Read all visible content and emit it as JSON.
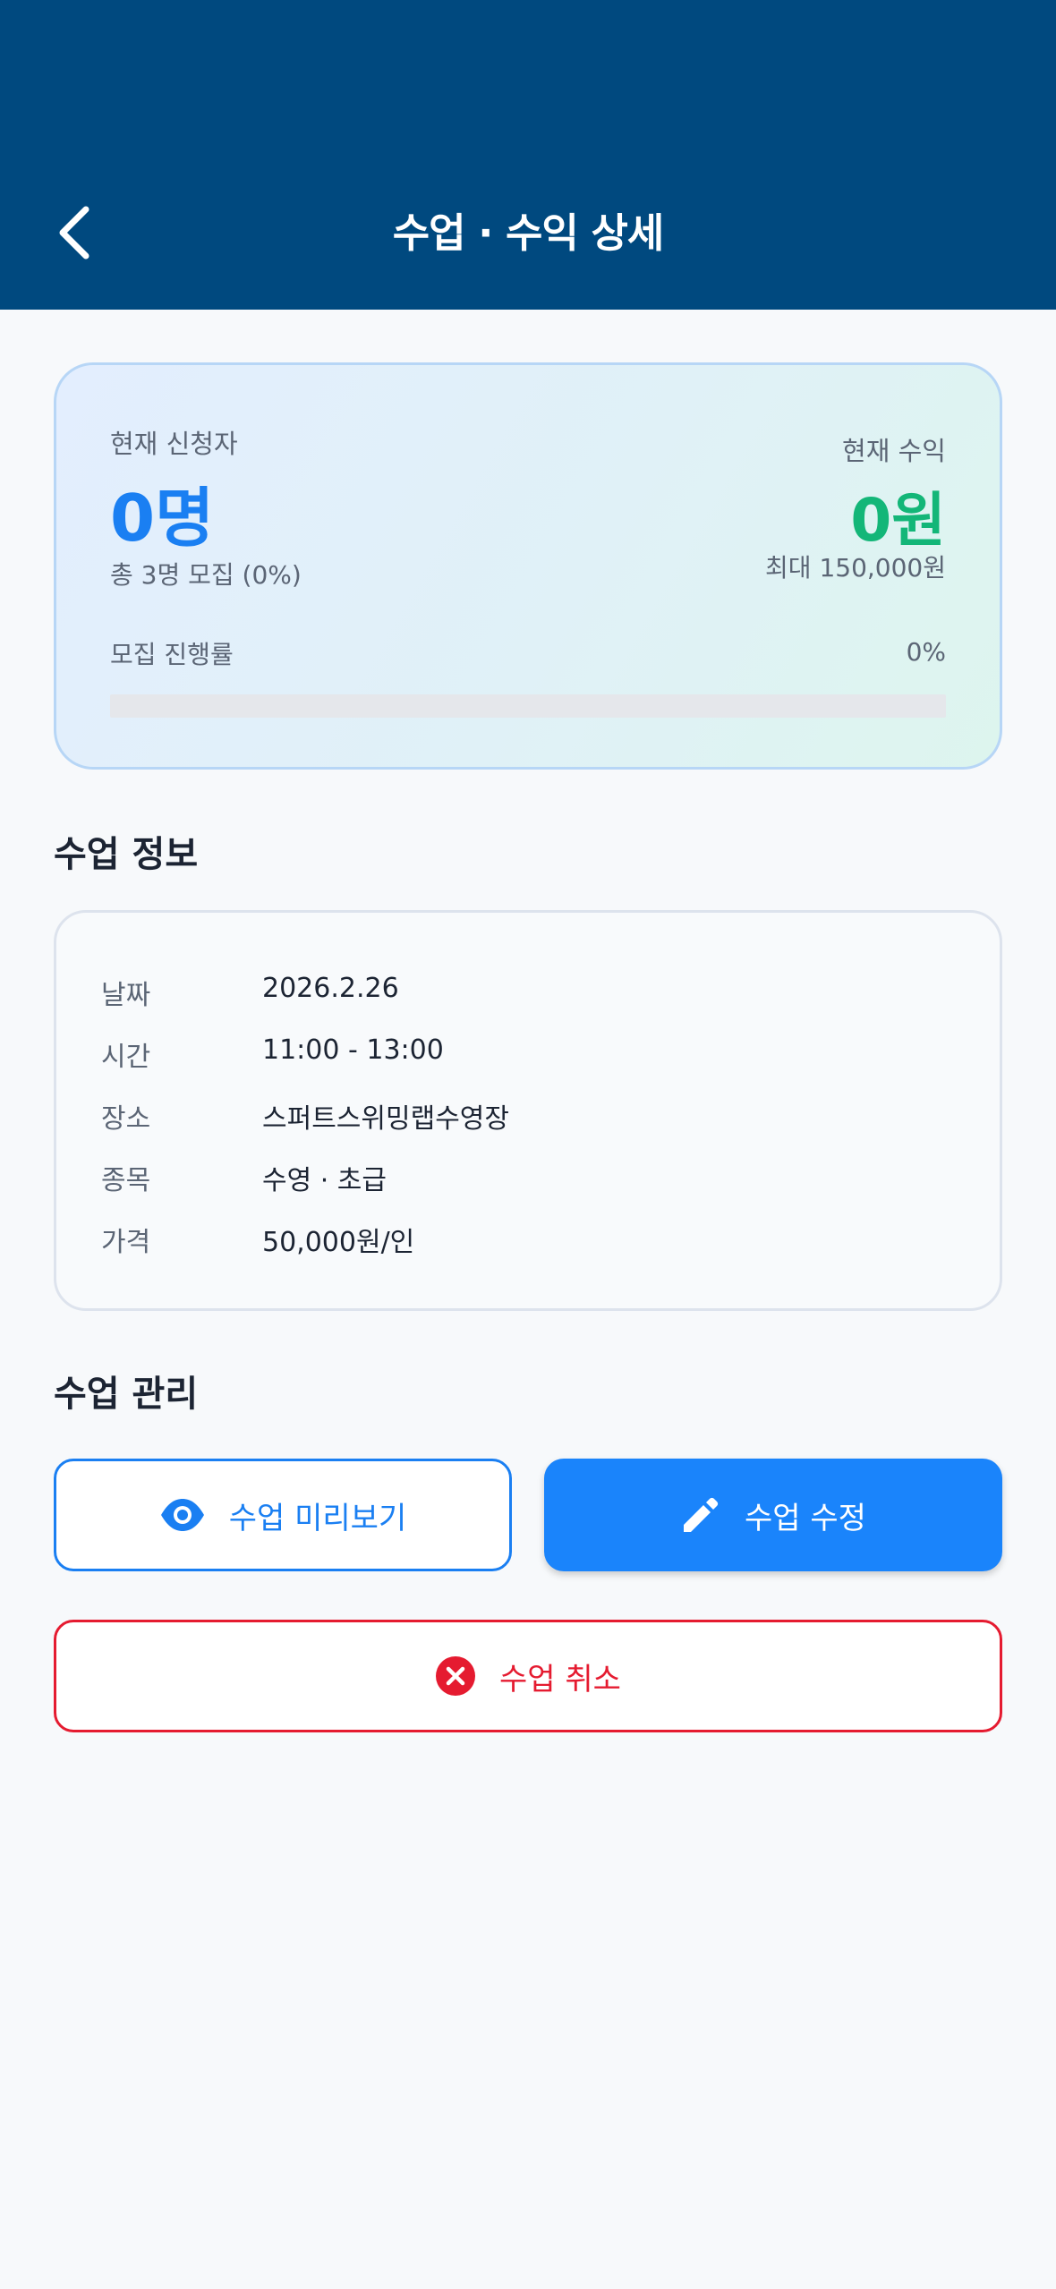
{
  "header": {
    "title": "수업 · 수익 상세",
    "back_icon": "chevron-left-icon"
  },
  "summary": {
    "applicants_label": "현재 신청자",
    "applicants_value": "0명",
    "applicants_sub": "총 3명 모집 (0%)",
    "revenue_label": "현재 수익",
    "revenue_value": "0원",
    "revenue_sub": "최대 150,000원",
    "progress_label": "모집 진행률",
    "progress_percent": "0%",
    "progress_fraction": 0,
    "colors": {
      "applicants": "#1a7ff2",
      "revenue": "#13b678"
    }
  },
  "info": {
    "section_title": "수업 정보",
    "rows": [
      {
        "key": "날짜",
        "value": "2026.2.26"
      },
      {
        "key": "시간",
        "value": "11:00 - 13:00"
      },
      {
        "key": "장소",
        "value": "스퍼트스위밍랩수영장"
      },
      {
        "key": "종목",
        "value": "수영 · 초급"
      },
      {
        "key": "가격",
        "value": "50,000원/인"
      }
    ]
  },
  "manage": {
    "section_title": "수업 관리",
    "preview_label": "수업 미리보기",
    "preview_icon": "eye-icon",
    "edit_label": "수업 수정",
    "edit_icon": "pencil-icon",
    "cancel_label": "수업 취소",
    "cancel_icon": "close-circle-icon",
    "colors": {
      "primary": "#1a84fb",
      "danger": "#e51b30"
    }
  }
}
